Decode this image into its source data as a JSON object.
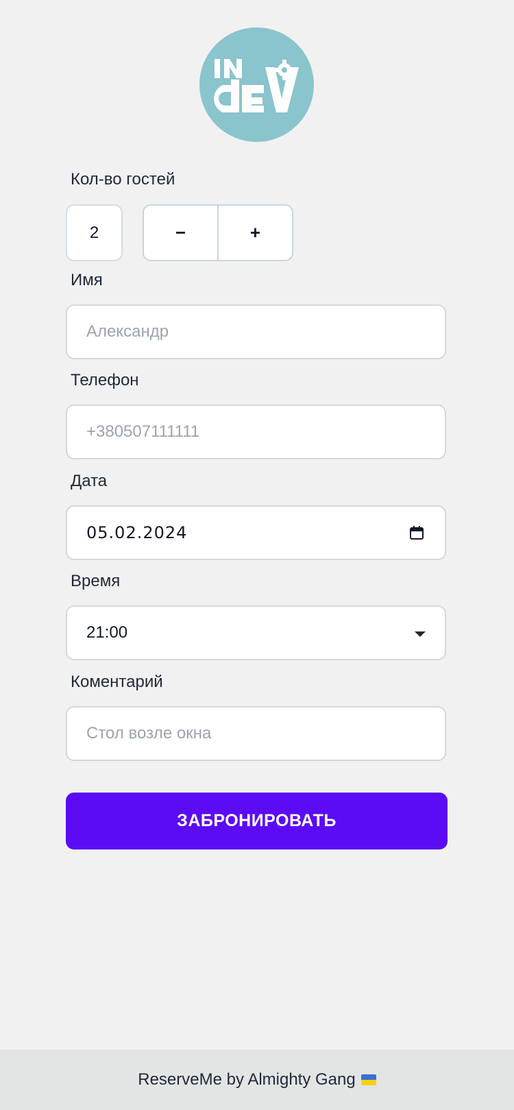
{
  "brand": {
    "logo_text": "INdEV",
    "logo_color": "#8ac4cd"
  },
  "form": {
    "guests": {
      "label": "Кол-во гостей",
      "value": "2",
      "decrement_label": "−",
      "increment_label": "+"
    },
    "name": {
      "label": "Имя",
      "placeholder": "Александр"
    },
    "phone": {
      "label": "Телефон",
      "placeholder": "+380507111111"
    },
    "date": {
      "label": "Дата",
      "value": "05.02.2024",
      "icon": "calendar-icon"
    },
    "time": {
      "label": "Время",
      "value": "21:00",
      "icon": "caret-down-icon"
    },
    "comment": {
      "label": "Коментарий",
      "placeholder": "Стол возле окна"
    },
    "submit_label": "ЗАБРОНИРОВАТЬ",
    "submit_color": "#5b0cf5"
  },
  "footer": {
    "text": "ReserveMe by Almighty Gang",
    "flag_icon": "ukraine-flag-icon"
  }
}
